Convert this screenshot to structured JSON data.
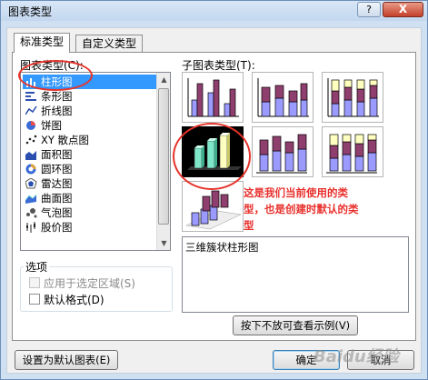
{
  "window": {
    "title": "图表类型",
    "help_label": "?",
    "close_label": "X"
  },
  "tabs": [
    {
      "label": "标准类型"
    },
    {
      "label": "自定义类型"
    }
  ],
  "chart_type": {
    "label": "图表类型(C):",
    "items": [
      {
        "label": "柱形图",
        "icon": "column-chart-icon"
      },
      {
        "label": "条形图",
        "icon": "bar-chart-icon"
      },
      {
        "label": "折线图",
        "icon": "line-chart-icon"
      },
      {
        "label": "饼图",
        "icon": "pie-chart-icon"
      },
      {
        "label": "XY 散点图",
        "icon": "scatter-chart-icon"
      },
      {
        "label": "面积图",
        "icon": "area-chart-icon"
      },
      {
        "label": "圆环图",
        "icon": "doughnut-chart-icon"
      },
      {
        "label": "雷达图",
        "icon": "radar-chart-icon"
      },
      {
        "label": "曲面图",
        "icon": "surface-chart-icon"
      },
      {
        "label": "气泡图",
        "icon": "bubble-chart-icon"
      },
      {
        "label": "股价图",
        "icon": "stock-chart-icon"
      }
    ],
    "selected": "柱形图"
  },
  "options": {
    "group_label": "选项",
    "apply_to_selection_label": "应用于选定区域(S)",
    "default_format_label": "默认格式(D)"
  },
  "subtype": {
    "label": "子图表类型(T):",
    "selected_description": "三维簇状柱形图"
  },
  "annotation": {
    "text": "这是我们当前使用的类型，也是创建时默认的类型"
  },
  "buttons": {
    "preview_label": "按下不放可查看示例(V)",
    "set_default_label": "设置为默认图表(E)",
    "ok_label": "确定",
    "cancel_label": "取消"
  },
  "watermark": "Baidu经验",
  "colors": {
    "bar_purple": "#8f3f6e",
    "bar_blue": "#9b9bff",
    "bar_yellow": "#ffffc0",
    "bar_teal": "#7fe7c9",
    "annotation_red": "#e6332a",
    "selection_blue": "#3399ff"
  }
}
